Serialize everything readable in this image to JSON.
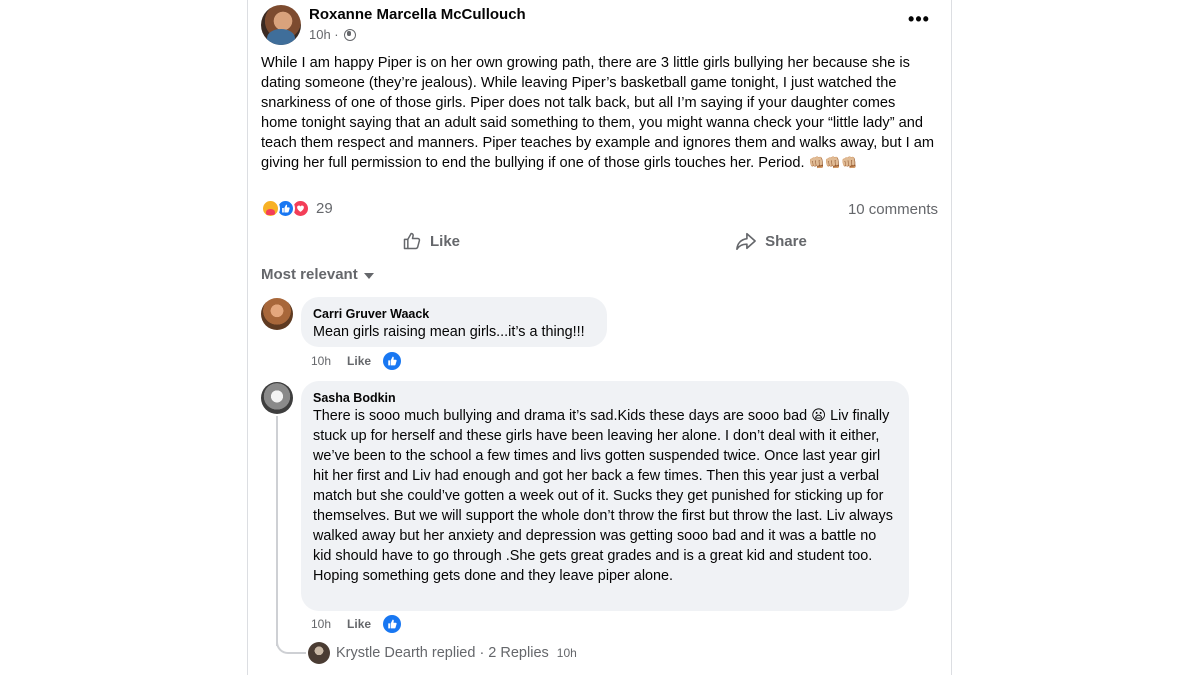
{
  "post": {
    "author": "Roxanne Marcella McCullouch",
    "time": "10h ·",
    "text": "While I am happy Piper is on her own growing path, there are 3 little girls bullying her because she is dating someone (they’re jealous). While leaving Piper’s basketball game tonight, I just watched the snarkiness of one of those girls. Piper does not talk back, but all I’m saying if your daughter comes home tonight saying that an adult said something to them, you might wanna check your “little lady” and teach them respect and manners. Piper teaches by example and ignores them and walks away, but I am giving her full permission to end the bullying if one of those girls touches her. Period.",
    "trailing_emoji": "👊🏼👊🏼👊🏼",
    "reaction_count": "29",
    "comments_count": "10 comments",
    "more_label": "•••"
  },
  "actions": {
    "like_label": "Like",
    "share_label": "Share"
  },
  "sort": {
    "label": "Most relevant"
  },
  "comments": [
    {
      "name": "Carri Gruver Waack",
      "text": "Mean girls raising mean girls...it’s a thing!!!",
      "time": "10h",
      "like_label": "Like"
    },
    {
      "name": "Sasha Bodkin",
      "text": "There is sooo much bullying and drama it’s sad.Kids these days are sooo bad 😦 Liv finally stuck up for herself and these girls have been leaving her alone. I don’t deal with it either, we’ve been to the school a few times and livs gotten suspended twice. Once last year girl hit her first and Liv had enough and got her back a few times. Then this year just a verbal match but she could’ve gotten a week out of it. Sucks they get punished for sticking up for themselves. But we will support the whole don’t throw the first but throw the last. Liv always walked away but her anxiety and depression was getting sooo bad and it was a battle no kid should have to go through .She gets great grades and is a great kid and student too. Hoping something gets done and they leave piper alone.",
      "time": "10h",
      "like_label": "Like"
    }
  ],
  "replies": {
    "text": "Krystle Dearth replied · 2 Replies",
    "time": "10h"
  },
  "colors": {
    "accent": "#1877f2",
    "love": "#f33e58",
    "care": "#f7b125",
    "secondary_text": "#65676b",
    "bubble": "#f0f2f5"
  },
  "icons": [
    "globe-icon",
    "more-icon",
    "like-reaction-icon",
    "love-reaction-icon",
    "care-reaction-icon",
    "thumbs-up-icon",
    "share-icon",
    "caret-down-icon"
  ]
}
